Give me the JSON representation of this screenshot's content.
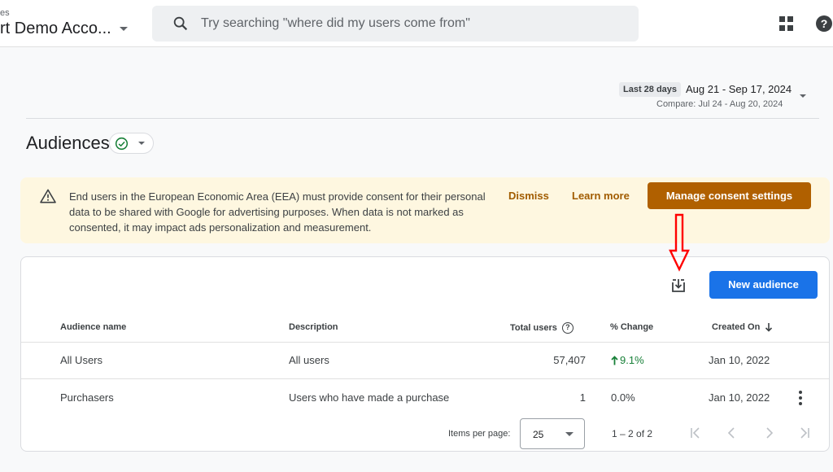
{
  "header": {
    "account_small": "es",
    "account_name": "rt Demo Acco...",
    "search_placeholder": "Try searching \"where did my users come from\""
  },
  "date_range": {
    "chip": "Last 28 days",
    "range": "Aug 21 - Sep 17, 2024",
    "compare": "Compare: Jul 24 - Aug 20, 2024"
  },
  "page": {
    "title": "Audiences"
  },
  "banner": {
    "text": "End users in the European Economic Area (EEA) must provide consent for their personal data to be shared with Google for advertising purposes. When data is not marked as consented, it may impact ads personalization and measurement.",
    "dismiss": "Dismiss",
    "learn_more": "Learn more",
    "manage": "Manage consent settings"
  },
  "toolbar": {
    "new_audience": "New audience"
  },
  "table": {
    "headers": {
      "name": "Audience name",
      "description": "Description",
      "total_users": "Total users",
      "change": "% Change",
      "created": "Created On"
    },
    "rows": [
      {
        "name": "All Users",
        "description": "All users",
        "total_users": "57,407",
        "change": "9.1%",
        "created": "Jan 10, 2022"
      },
      {
        "name": "Purchasers",
        "description": "Users who have made a purchase",
        "total_users": "1",
        "change": "0.0%",
        "created": "Jan 10, 2022"
      }
    ]
  },
  "pagination": {
    "items_per_page_label": "Items per page:",
    "items_per_page": "25",
    "range": "1 – 2 of 2"
  },
  "colors": {
    "primary_button": "#1a73e8",
    "consent_button": "#b06000",
    "banner_bg": "#fef7e0",
    "positive": "#188038",
    "annotation": "#ff0000"
  }
}
